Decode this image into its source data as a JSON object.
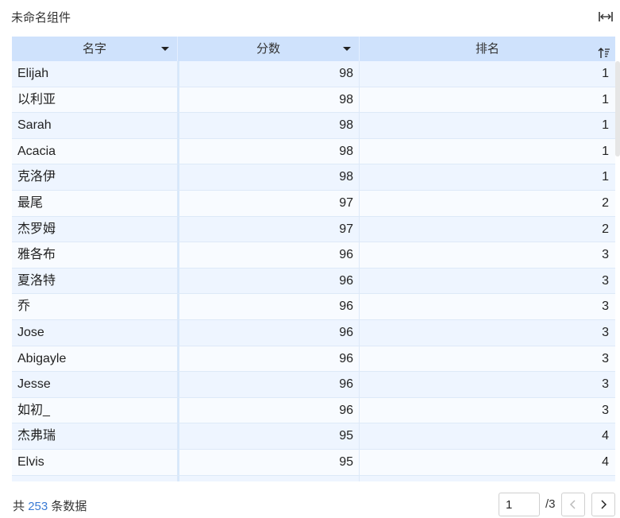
{
  "widget": {
    "title": "未命名组件"
  },
  "icons": {
    "expand": "expand-width-icon",
    "sort_asc": "sort-ascending-icon",
    "prev": "chevron-left-icon",
    "next": "chevron-right-icon"
  },
  "table": {
    "columns": [
      {
        "label": "名字",
        "sort": "filter-dropdown"
      },
      {
        "label": "分数",
        "sort": "filter-dropdown"
      },
      {
        "label": "排名",
        "sort": "ascending"
      }
    ],
    "rows": [
      {
        "name": "Elijah",
        "score": "98",
        "rank": "1"
      },
      {
        "name": "以利亚",
        "score": "98",
        "rank": "1"
      },
      {
        "name": "Sarah",
        "score": "98",
        "rank": "1"
      },
      {
        "name": "Acacia",
        "score": "98",
        "rank": "1"
      },
      {
        "name": "克洛伊",
        "score": "98",
        "rank": "1"
      },
      {
        "name": "最尾",
        "score": "97",
        "rank": "2"
      },
      {
        "name": "杰罗姆",
        "score": "97",
        "rank": "2"
      },
      {
        "name": "雅各布",
        "score": "96",
        "rank": "3"
      },
      {
        "name": "夏洛特",
        "score": "96",
        "rank": "3"
      },
      {
        "name": "乔",
        "score": "96",
        "rank": "3"
      },
      {
        "name": "Jose",
        "score": "96",
        "rank": "3"
      },
      {
        "name": "Abigayle",
        "score": "96",
        "rank": "3"
      },
      {
        "name": "Jesse",
        "score": "96",
        "rank": "3"
      },
      {
        "name": "如初_",
        "score": "96",
        "rank": "3"
      },
      {
        "name": "杰弗瑞",
        "score": "95",
        "rank": "4"
      },
      {
        "name": "Elvis",
        "score": "95",
        "rank": "4"
      },
      {
        "name": "",
        "score": "",
        "rank": ""
      }
    ]
  },
  "footer": {
    "prefix": "共",
    "total": "253",
    "suffix": "条数据",
    "current_page": "1",
    "page_total": "/3"
  },
  "colors": {
    "header_bg": "#cfe2fc",
    "row_odd": "#eef5ff",
    "row_even": "#f8fbff",
    "accent": "#3a7bd5"
  }
}
